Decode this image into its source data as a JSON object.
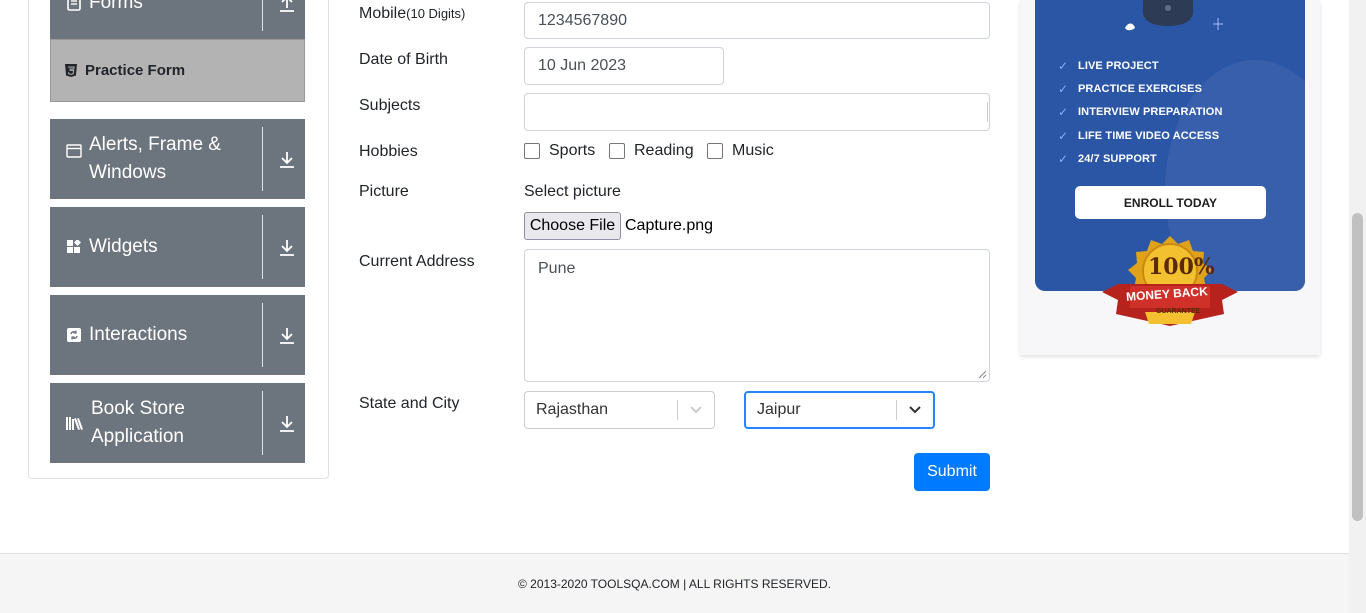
{
  "sidebar": {
    "forms_label": "Forms",
    "practice_form": "Practice Form",
    "groups": [
      {
        "label": "Alerts, Frame & Windows"
      },
      {
        "label": "Widgets"
      },
      {
        "label": "Interactions"
      },
      {
        "label": "Book Store Application"
      }
    ]
  },
  "form": {
    "mobile_label": "Mobile",
    "mobile_hint": "(10 Digits)",
    "mobile_value": "1234567890",
    "dob_label": "Date of Birth",
    "dob_value": "10 Jun 2023",
    "subjects_label": "Subjects",
    "subjects_value": "",
    "hobbies_label": "Hobbies",
    "hobbies": [
      "Sports",
      "Reading",
      "Music"
    ],
    "picture_label": "Picture",
    "select_picture": "Select picture",
    "choose_file": "Choose File",
    "file_name": "Capture.png",
    "address_label": "Current Address",
    "address_value": "Pune",
    "state_city_label": "State and City",
    "state_value": "Rajasthan",
    "city_value": "Jaipur",
    "submit": "Submit"
  },
  "ad": {
    "items": [
      "LIVE PROJECT",
      "PRACTICE EXERCISES",
      "INTERVIEW PREPARATION",
      "LIFE TIME VIDEO ACCESS",
      "24/7 SUPPORT"
    ],
    "enroll": "ENROLL TODAY",
    "badge_percent": "100%",
    "badge_text": "MONEY BACK",
    "badge_sub": "GUARANTEE"
  },
  "footer": {
    "text": "© 2013-2020 TOOLSQA.COM | ALL RIGHTS RESERVED."
  },
  "colors": {
    "sidebar_group": "#6c757d",
    "practice_active": "#b3b3b3",
    "primary": "#007bff",
    "ad_blue": "#2b56a6"
  }
}
